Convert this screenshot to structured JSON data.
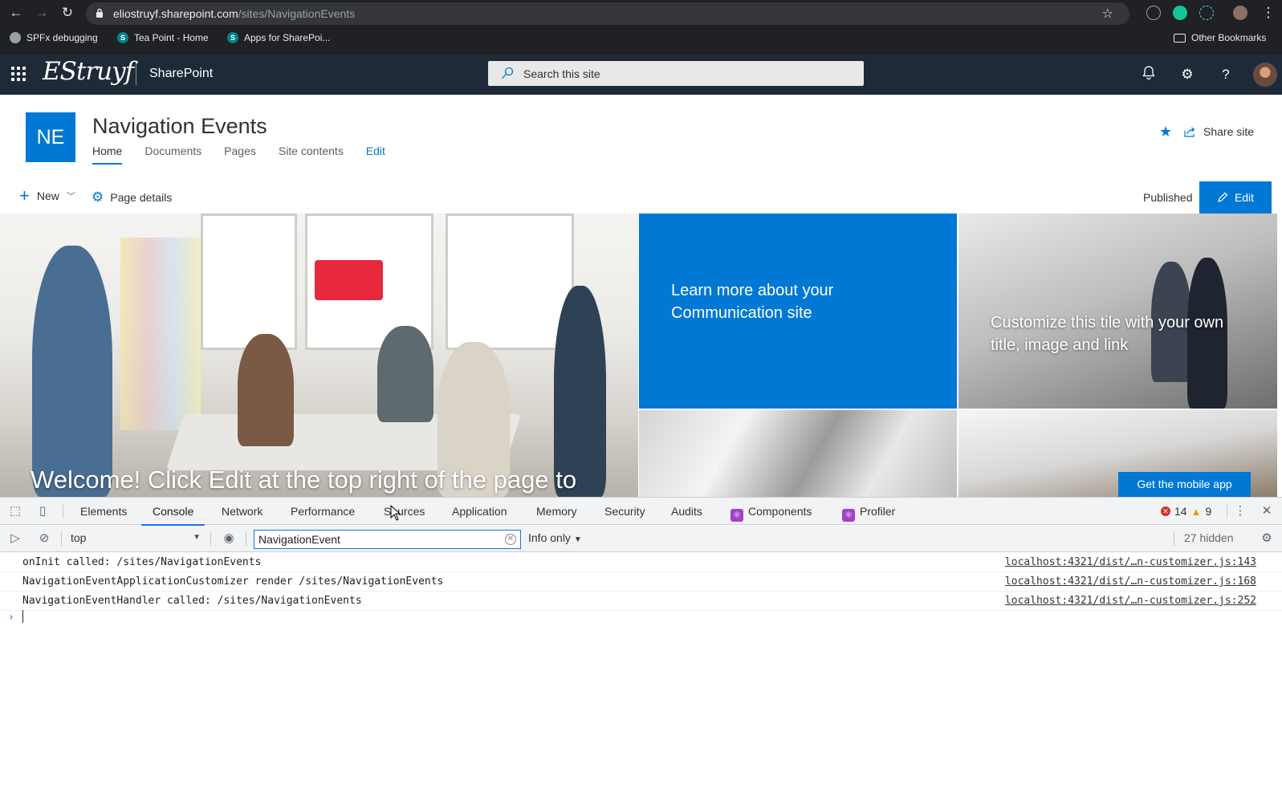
{
  "browser": {
    "url_host": "eliostruyf.sharepoint.com",
    "url_path": "/sites/NavigationEvents",
    "bookmarks": [
      {
        "label": "SPFx debugging"
      },
      {
        "label": "Tea Point - Home"
      },
      {
        "label": "Apps for SharePoi..."
      }
    ],
    "other_bookmarks": "Other Bookmarks"
  },
  "suitebar": {
    "logo_text": "EStruyf",
    "app_name": "SharePoint",
    "search_placeholder": "Search this site",
    "icons": [
      "waffle-icon",
      "bell-icon",
      "gear-icon",
      "help-icon",
      "avatar"
    ]
  },
  "site": {
    "logo_initials": "NE",
    "title": "Navigation Events",
    "nav": [
      {
        "label": "Home",
        "active": true
      },
      {
        "label": "Documents"
      },
      {
        "label": "Pages"
      },
      {
        "label": "Site contents"
      },
      {
        "label": "Edit"
      }
    ],
    "share_label": "Share site"
  },
  "commandbar": {
    "new_label": "New",
    "page_details_label": "Page details",
    "status": "Published",
    "edit_label": "Edit"
  },
  "hero": {
    "main_caption": "Welcome! Click Edit at the top right of the page to",
    "tile_blue_text": "Learn more about your Communication site",
    "tile_photo_text": "Customize this tile with your own title, image and link",
    "mobile_button": "Get the mobile app",
    "colors": {
      "accent": "#0078d4",
      "lamp": "#e8283d"
    }
  },
  "devtools": {
    "tabs": [
      "Elements",
      "Console",
      "Network",
      "Performance",
      "Sources",
      "Application",
      "Memory",
      "Security",
      "Audits",
      "Components",
      "Profiler"
    ],
    "active_tab": "Console",
    "error_count": "14",
    "warning_count": "9",
    "context": "top",
    "filter_value": "NavigationEvent",
    "level": "Info only",
    "hidden": "27 hidden",
    "console": [
      {
        "message": "onInit called: /sites/NavigationEvents",
        "source": "localhost:4321/dist/…n-customizer.js:143"
      },
      {
        "message": "NavigationEventApplicationCustomizer render /sites/NavigationEvents",
        "source": "localhost:4321/dist/…n-customizer.js:168"
      },
      {
        "message": "NavigationEventHandler called: /sites/NavigationEvents",
        "source": "localhost:4321/dist/…n-customizer.js:252"
      }
    ]
  }
}
